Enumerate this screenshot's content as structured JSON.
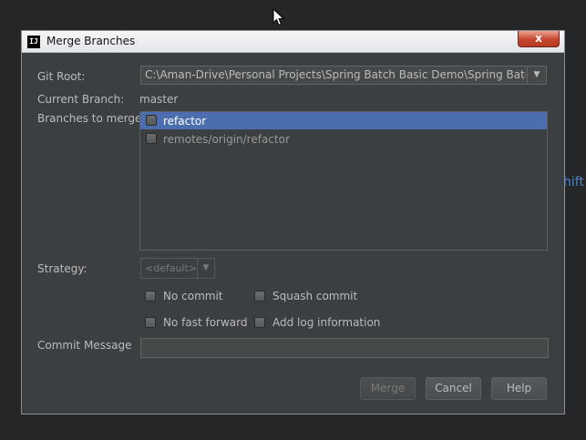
{
  "background": {
    "partial_text": "hift"
  },
  "dialog": {
    "title": "Merge Branches",
    "app_icon_text": "IJ",
    "close_glyph": "x"
  },
  "form": {
    "git_root_label": "Git Root:",
    "git_root_value": "C:\\Aman-Drive\\Personal Projects\\Spring Batch Basic Demo\\Spring Batch Demo",
    "current_branch_label": "Current Branch:",
    "current_branch_value": "master",
    "branches_label": "Branches to merge:",
    "branches": [
      {
        "name": "refactor",
        "checked": false,
        "selected": true
      },
      {
        "name": "remotes/origin/refactor",
        "checked": false,
        "selected": false
      }
    ],
    "strategy_label": "Strategy:",
    "strategy_value": "<default>",
    "options": {
      "no_commit": "No commit",
      "squash_commit": "Squash commit",
      "no_fast_forward": "No fast forward",
      "add_log_information": "Add log information"
    },
    "commit_message_label": "Commit Message",
    "commit_message_value": ""
  },
  "buttons": {
    "merge": "Merge",
    "cancel": "Cancel",
    "help": "Help"
  },
  "colors": {
    "dialog_bg": "#3c3f41",
    "selection": "#4b6eaf",
    "close_red": "#c7462d",
    "link_blue": "#4a86c8"
  }
}
